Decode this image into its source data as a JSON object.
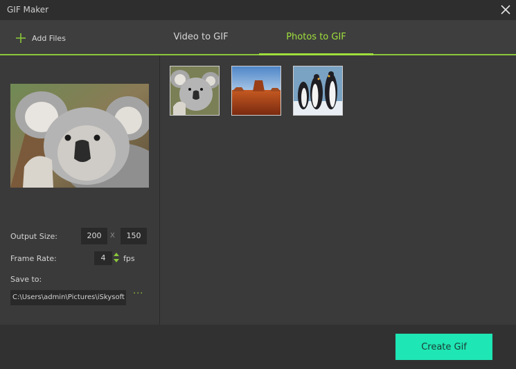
{
  "window": {
    "title": "GIF Maker"
  },
  "toolbar": {
    "add_files_label": "Add Files",
    "tabs": [
      {
        "label": "Video to GIF",
        "active": false
      },
      {
        "label": "Photos to GIF",
        "active": true
      }
    ]
  },
  "settings": {
    "output_size_label": "Output Size:",
    "width": "200",
    "separator": "X",
    "height": "150",
    "frame_rate_label": "Frame Rate:",
    "frame_rate": "4",
    "fps_label": "fps",
    "save_to_label": "Save to:",
    "save_path": "C:\\Users\\admin\\Pictures\\iSkysoft",
    "browse_label": "···"
  },
  "thumbnails": [
    {
      "name": "koala",
      "selected": true
    },
    {
      "name": "desert",
      "selected": false
    },
    {
      "name": "penguins",
      "selected": false
    }
  ],
  "footer": {
    "create_label": "Create Gif"
  },
  "colors": {
    "accent_green": "#9fe03c",
    "create_button": "#1ee6b4",
    "background": "#3b3a3a"
  }
}
